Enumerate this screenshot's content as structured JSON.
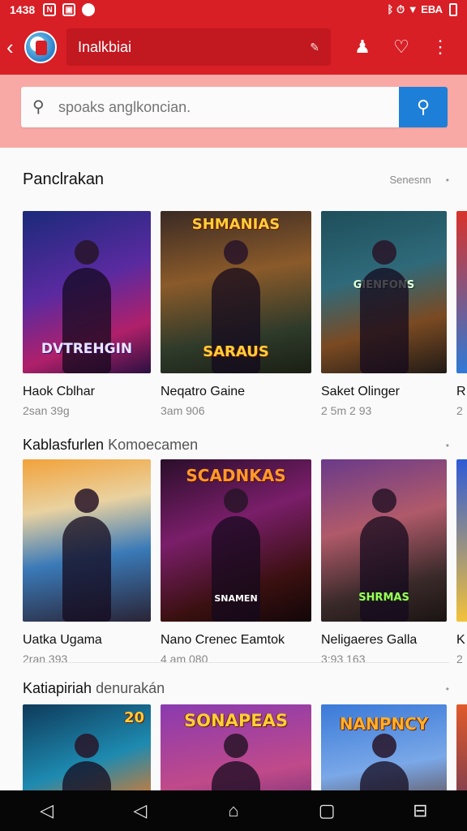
{
  "status_bar": {
    "time": "1438",
    "right_text": "ᛒ ⏱ ▼ ЕВА",
    "icons": [
      "sim-icon",
      "notification-icon",
      "app-icon",
      "bluetooth-icon",
      "alarm-icon",
      "wifi-icon",
      "signal-icon",
      "battery-icon"
    ]
  },
  "app_bar": {
    "title": "Inalkbiai",
    "icons": [
      "back-icon",
      "app-logo",
      "edit-icon",
      "profile-icon",
      "heart-icon",
      "more-icon"
    ]
  },
  "search": {
    "placeholder": "spoaks anglkoncian."
  },
  "sections": [
    {
      "title": "Panclrakan",
      "subtitle": "",
      "more": "Senesnn",
      "cards": [
        {
          "name": "Haok Cblhar",
          "meta": "2san 39g",
          "logo": "DVTREHGIN"
        },
        {
          "name": "Neqatro Gaine",
          "meta": "3am 906",
          "logo": "SHMANIAS",
          "logo2": "SARAUS"
        },
        {
          "name": "Saket Olinger",
          "meta": "2 5m 2 93",
          "logo": "GIENFONS"
        },
        {
          "name": "R",
          "meta": "2"
        }
      ]
    },
    {
      "title": "Kablasfurlen",
      "subtitle": "Komoecamen",
      "more": "",
      "cards": [
        {
          "name": "Uatka Ugama",
          "meta": "2ran 393",
          "logo": ""
        },
        {
          "name": "Nano Crenec Eamtok",
          "meta": "4 am 080",
          "logo": "SCADNKAS",
          "logo2": "SNAMEN"
        },
        {
          "name": "Neligaeres Galla",
          "meta": "3:93 163",
          "logo": "SHRMAS"
        },
        {
          "name": "K",
          "meta": "2"
        }
      ]
    },
    {
      "title": "Katiapiriah",
      "subtitle": "denurakán",
      "more": "",
      "cards": [
        {
          "name": "",
          "meta": "",
          "logo": "20"
        },
        {
          "name": "",
          "meta": "",
          "logo": "SONAPEAS"
        },
        {
          "name": "",
          "meta": "",
          "logo": "NANPNCY"
        },
        {
          "name": "",
          "meta": ""
        }
      ]
    }
  ],
  "colors": {
    "app_red": "#d81f26",
    "search_band": "#f9a9a5",
    "search_button": "#1e7fd8"
  }
}
